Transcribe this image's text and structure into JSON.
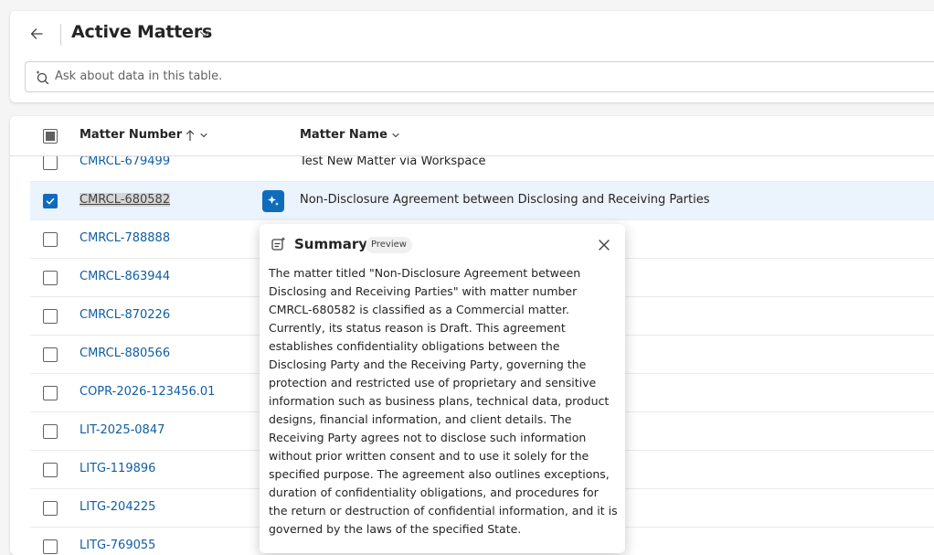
{
  "header": {
    "title": "Active Matters",
    "search_placeholder": "Ask about data in this table."
  },
  "grid": {
    "columns": {
      "matter_number": "Matter Number",
      "matter_name": "Matter Name"
    },
    "rows": [
      {
        "number": "CMRCL-679499",
        "name": "Test New Matter via Workspace",
        "selected": false
      },
      {
        "number": "CMRCL-680582",
        "name": "Non-Disclosure Agreement between Disclosing and Receiving Parties",
        "selected": true
      },
      {
        "number": "CMRCL-788888",
        "name": "",
        "selected": false
      },
      {
        "number": "CMRCL-863944",
        "name": "",
        "selected": false
      },
      {
        "number": "CMRCL-870226",
        "name": "",
        "selected": false
      },
      {
        "number": "CMRCL-880566",
        "name": "",
        "selected": false
      },
      {
        "number": "COPR-2026-123456.01",
        "name": "",
        "selected": false
      },
      {
        "number": "LIT-2025-0847",
        "name": "",
        "selected": false
      },
      {
        "number": "LITG-119896",
        "name": "",
        "selected": false
      },
      {
        "number": "LITG-204225",
        "name": "",
        "selected": false
      },
      {
        "number": "LITG-769055",
        "name": "",
        "selected": false
      }
    ]
  },
  "summary": {
    "title": "Summary",
    "badge": "Preview",
    "text": "The matter titled \"Non-Disclosure Agreement between Disclosing and Receiving Parties\" with matter number CMRCL-680582 is classified as a Commercial matter. Currently, its status reason is Draft. This agreement establishes confidentiality obligations between the Disclosing Party and the Receiving Party, governing the protection and restricted use of proprietary and sensitive information such as business plans, technical data, product designs, financial information, and client details. The Receiving Party agrees not to disclose such information without prior written consent and to use it solely for the specified purpose. The agreement also outlines exceptions, duration of confidentiality obligations, and procedures for the return or destruction of confidential information, and it is governed by the laws of the specified State."
  },
  "colors": {
    "accent": "#0f6cbd",
    "link": "#115ea3",
    "selected_row": "#ebf3fc"
  },
  "icons": [
    "arrow-left-icon",
    "chevron-down-icon",
    "copilot-search-icon",
    "sort-ascending-icon",
    "checkmark-icon",
    "sparkle-icon",
    "summary-icon",
    "close-icon"
  ]
}
